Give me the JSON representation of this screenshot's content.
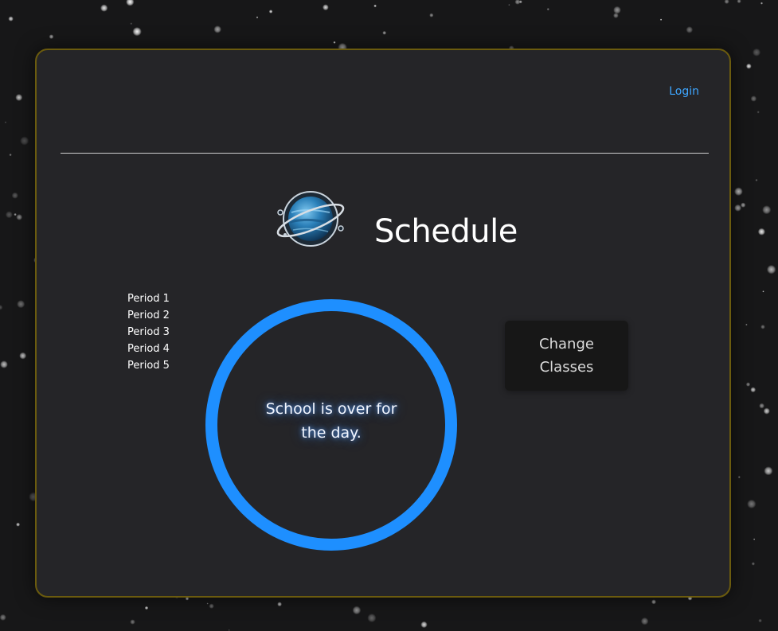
{
  "header": {
    "login_label": "Login"
  },
  "hero": {
    "title": "Schedule",
    "logo_icon": "planet-logo-icon"
  },
  "periods": [
    "Period 1",
    "Period 2",
    "Period 3",
    "Period 4",
    "Period 5"
  ],
  "status": {
    "message": "School is over for the day."
  },
  "actions": {
    "change_classes_label": "Change Classes"
  },
  "colors": {
    "accent": "#1e8fff",
    "link": "#3ea6ff",
    "card_background": "#252528",
    "card_border": "#6b5b0e",
    "page_background": "#1a1a1b"
  }
}
